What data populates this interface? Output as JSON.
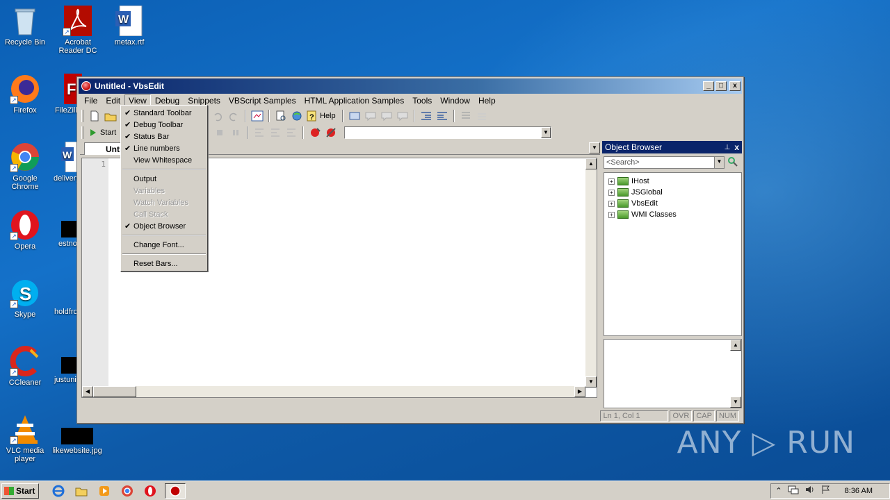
{
  "desktop": {
    "icons": [
      {
        "label": "Recycle Bin"
      },
      {
        "label": "Acrobat Reader DC"
      },
      {
        "label": "metax.rtf"
      },
      {
        "label": "Firefox"
      },
      {
        "label": "FileZilla"
      },
      {
        "label": "Google Chrome"
      },
      {
        "label": "delivery"
      },
      {
        "label": "Opera"
      },
      {
        "label": "estno"
      },
      {
        "label": "Skype"
      },
      {
        "label": "holdfro"
      },
      {
        "label": "CCleaner"
      },
      {
        "label": "justuni"
      },
      {
        "label": "VLC media player"
      },
      {
        "label": "likewebsite.jpg"
      }
    ],
    "watermark": "ANY ▷ RUN"
  },
  "window": {
    "title": "Untitled - VbsEdit",
    "buttons": {
      "min": "_",
      "max": "□",
      "close": "x"
    },
    "menu": [
      "File",
      "Edit",
      "View",
      "Debug",
      "Snippets",
      "VBScript Samples",
      "HTML Application Samples",
      "Tools",
      "Window",
      "Help"
    ],
    "toolbar": {
      "help_label": "Help",
      "start_label": "Start"
    },
    "editor": {
      "tab_label": "Untitled",
      "line_number": "1"
    },
    "object_browser": {
      "title": "Object Browser",
      "pin": "⊥",
      "close": "x",
      "search_placeholder": "<Search>",
      "tree": [
        "IHost",
        "JSGlobal",
        "VbsEdit",
        "WMI Classes"
      ]
    },
    "statusbar": {
      "position": "Ln 1, Col 1",
      "ovr": "OVR",
      "cap": "CAP",
      "num": "NUM"
    }
  },
  "view_menu": {
    "items": [
      {
        "label": "Standard Toolbar",
        "checked": true,
        "disabled": false
      },
      {
        "label": "Debug Toolbar",
        "checked": true,
        "disabled": false
      },
      {
        "label": "Status Bar",
        "checked": true,
        "disabled": false
      },
      {
        "label": "Line numbers",
        "checked": true,
        "disabled": false
      },
      {
        "label": "View Whitespace",
        "checked": false,
        "disabled": false
      },
      {
        "sep": true
      },
      {
        "label": "Output",
        "checked": false,
        "disabled": false
      },
      {
        "label": "Variables",
        "checked": false,
        "disabled": true
      },
      {
        "label": "Watch Variables",
        "checked": false,
        "disabled": true
      },
      {
        "label": "Call Stack",
        "checked": false,
        "disabled": true
      },
      {
        "label": "Object Browser",
        "checked": true,
        "disabled": false
      },
      {
        "sep": true
      },
      {
        "label": "Change Font...",
        "checked": false,
        "disabled": false
      },
      {
        "sep": true
      },
      {
        "label": "Reset Bars...",
        "checked": false,
        "disabled": false
      }
    ]
  },
  "taskbar": {
    "start_label": "Start",
    "clock": "8:36 AM"
  }
}
